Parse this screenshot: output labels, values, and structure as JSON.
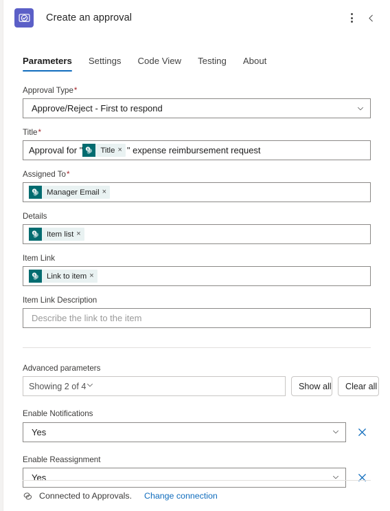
{
  "header": {
    "title": "Create an approval",
    "app_icon": "approval-app-icon",
    "more_options_icon": "more-options-icon",
    "collapse_icon": "chevron-left-icon",
    "accent_color": "#5b5fc7"
  },
  "tabs": [
    {
      "label": "Parameters",
      "active": true
    },
    {
      "label": "Settings",
      "active": false
    },
    {
      "label": "Code View",
      "active": false
    },
    {
      "label": "Testing",
      "active": false
    },
    {
      "label": "About",
      "active": false
    }
  ],
  "tab_accent_color": "#0f6cbd",
  "fields": {
    "approval_type": {
      "label": "Approval Type",
      "required": true,
      "value": "Approve/Reject - First to respond",
      "chevron_icon": "chevron-down-icon"
    },
    "title": {
      "label": "Title",
      "required": true,
      "prefix_text": "Approval for \"",
      "token": {
        "label": "Title",
        "icon": "sharepoint-icon",
        "remove": "×"
      },
      "suffix_text": "\" expense reimbursement request"
    },
    "assigned_to": {
      "label": "Assigned To",
      "required": true,
      "token": {
        "label": "Manager Email",
        "icon": "sharepoint-icon",
        "remove": "×"
      }
    },
    "details": {
      "label": "Details",
      "required": false,
      "token": {
        "label": "Item list",
        "icon": "sharepoint-icon",
        "remove": "×"
      }
    },
    "item_link": {
      "label": "Item Link",
      "required": false,
      "token": {
        "label": "Link to item",
        "icon": "sharepoint-icon",
        "remove": "×"
      }
    },
    "item_link_description": {
      "label": "Item Link Description",
      "required": false,
      "value": "",
      "placeholder": "Describe the link to the item"
    }
  },
  "advanced": {
    "label": "Advanced parameters",
    "select_value": "Showing 2 of 4",
    "chevron_icon": "chevron-down-icon",
    "show_all_label": "Show all",
    "clear_all_label": "Clear all"
  },
  "advanced_params": [
    {
      "label": "Enable Notifications",
      "value": "Yes",
      "chevron_icon": "chevron-down-icon",
      "remove_icon": "close-icon",
      "remove_glyph": "✕"
    },
    {
      "label": "Enable Reassignment",
      "value": "Yes",
      "chevron_icon": "chevron-down-icon",
      "remove_icon": "close-icon",
      "remove_glyph": "✕"
    }
  ],
  "footer": {
    "link_icon": "link-icon",
    "status_text": "Connected to Approvals.",
    "change_connection_label": "Change connection",
    "link_color": "#0f6cbd"
  },
  "token_colors": {
    "icon_bg": "#036c70",
    "chip_bg": "#e9f2f2"
  }
}
